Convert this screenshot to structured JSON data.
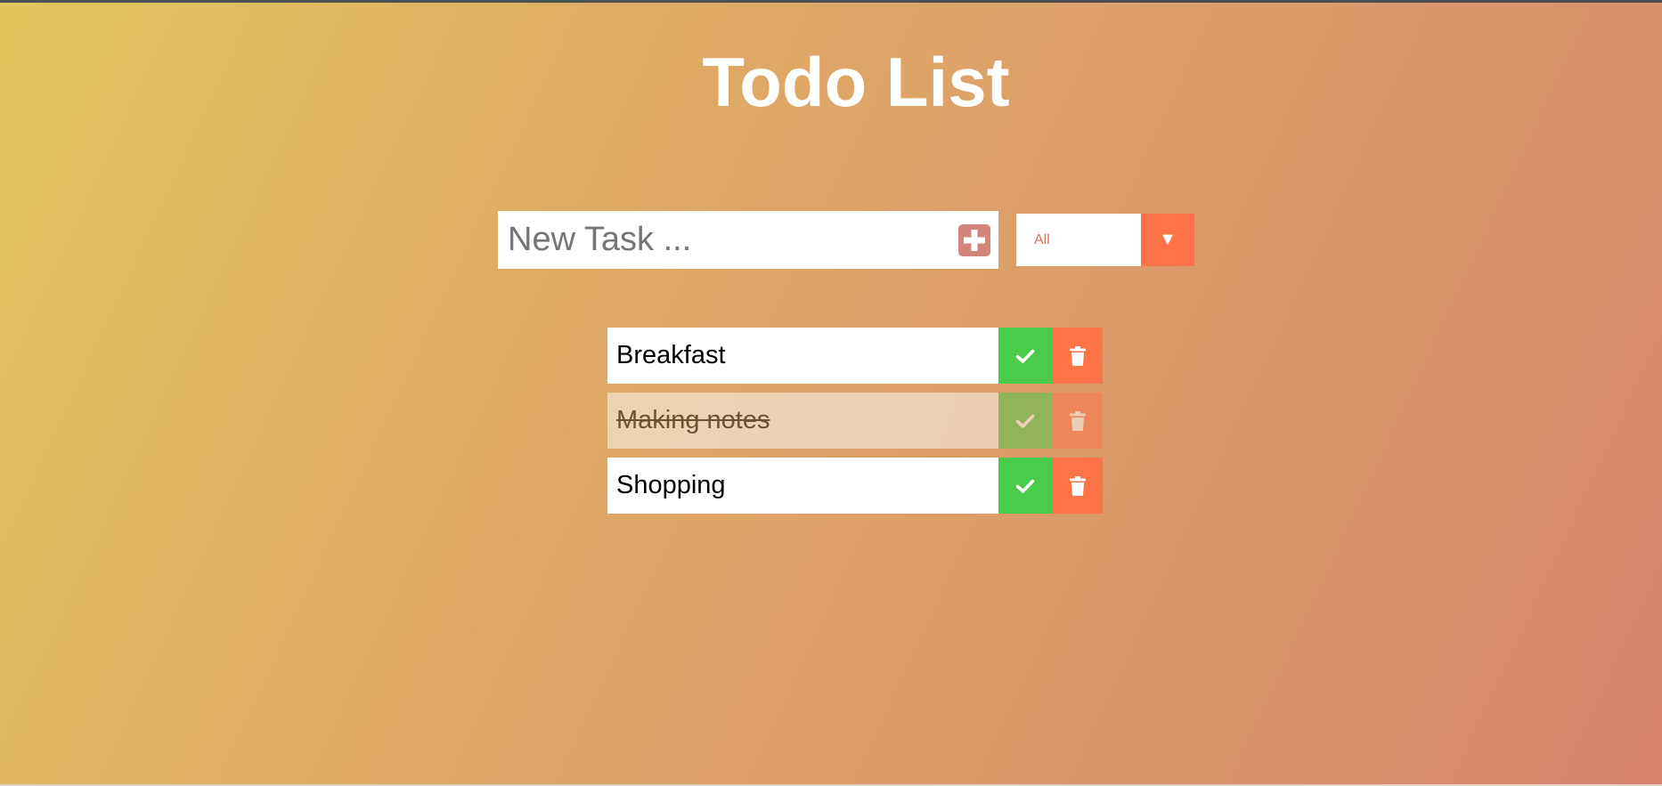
{
  "header": {
    "title": "Todo List"
  },
  "form": {
    "input_placeholder": "New Task ...",
    "add_icon": "plus-icon",
    "filter": {
      "selected": "All",
      "arrow": "▼"
    }
  },
  "todos": [
    {
      "text": "Breakfast",
      "completed": false
    },
    {
      "text": "Making notes",
      "completed": true
    },
    {
      "text": "Shopping",
      "completed": false
    }
  ],
  "colors": {
    "complete_button": "#49cc4a",
    "trash_button": "#ff7349",
    "add_button": "#d4847a",
    "gradient_start": "#e2c45e",
    "gradient_end": "#d8846c"
  }
}
